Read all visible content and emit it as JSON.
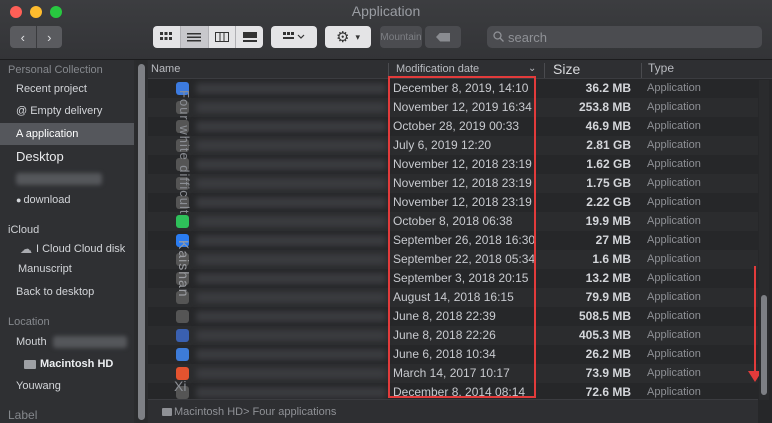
{
  "window": {
    "title": "Application",
    "search_placeholder": "search",
    "mountain_label": "Mountain",
    "nav_back": "‹",
    "nav_forward": "›"
  },
  "sidebar": {
    "personal_heading": "Personal Collection",
    "items": [
      {
        "label": "Recent project"
      },
      {
        "label": "@ Empty delivery"
      },
      {
        "label": "A application",
        "selected": true
      },
      {
        "label": "Desktop"
      },
      {
        "label": "download"
      }
    ],
    "icloud_heading": "iCloud",
    "icloud_items": [
      {
        "label": "I Cloud Cloud disk"
      },
      {
        "label": "Manuscript"
      },
      {
        "label": "Back to desktop"
      }
    ],
    "location_heading": "Location",
    "location_items": [
      {
        "label": "Mouth"
      },
      {
        "label": "Macintosh HD"
      },
      {
        "label": "Youwang"
      }
    ],
    "label_heading": "Label"
  },
  "columns": {
    "name": "Name",
    "date": "Modification date",
    "size": "Size",
    "type": "Type"
  },
  "vertical_overlay": {
    "text1": "Four white difficult",
    "text2": "Kaishan",
    "text3": "Xi"
  },
  "files": [
    {
      "date": "December 8, 2019, 14:10",
      "size": "36.2 MB",
      "type": "Application",
      "icon_color": "#3c7be0"
    },
    {
      "date": "November 12, 2019 16:34",
      "size": "253.8 MB",
      "type": "Application",
      "icon_color": "#555"
    },
    {
      "date": "October 28, 2019 00:33",
      "size": "46.9 MB",
      "type": "Application",
      "icon_color": "#555"
    },
    {
      "date": "July 6, 2019 12:20",
      "size": "2.81 GB",
      "type": "Application",
      "icon_color": "#555"
    },
    {
      "date": "November 12, 2018 23:19",
      "size": "1.62 GB",
      "type": "Application",
      "icon_color": "#555"
    },
    {
      "date": "November 12, 2018 23:19",
      "size": "1.75 GB",
      "type": "Application",
      "icon_color": "#555"
    },
    {
      "date": "November 12, 2018 23:19",
      "size": "2.22 GB",
      "type": "Application",
      "icon_color": "#555"
    },
    {
      "date": "October 8, 2018 06:38",
      "size": "19.9 MB",
      "type": "Application",
      "icon_color": "#2ec05a"
    },
    {
      "date": "September 26, 2018 16:30",
      "size": "27 MB",
      "type": "Application",
      "icon_color": "#2a7cf2"
    },
    {
      "date": "September 22, 2018 05:34",
      "size": "1.6 MB",
      "type": "Application",
      "icon_color": "#555"
    },
    {
      "date": "September 3, 2018 20:15",
      "size": "13.2 MB",
      "type": "Application",
      "icon_color": "#555"
    },
    {
      "date": "August 14, 2018 16:15",
      "size": "79.9 MB",
      "type": "Application",
      "icon_color": "#555"
    },
    {
      "date": "June 8, 2018 22:39",
      "size": "508.5 MB",
      "type": "Application",
      "icon_color": "#555"
    },
    {
      "date": "June 8, 2018 22:26",
      "size": "405.3 MB",
      "type": "Application",
      "icon_color": "#3a60b0"
    },
    {
      "date": "June 6, 2018 10:34",
      "size": "26.2 MB",
      "type": "Application",
      "icon_color": "#3d7bd8"
    },
    {
      "date": "March 14, 2017 10:17",
      "size": "73.9 MB",
      "type": "Application",
      "icon_color": "#e4532f"
    },
    {
      "date": "December 8, 2014 08:14",
      "size": "72.6 MB",
      "type": "Application",
      "icon_color": "#555"
    }
  ],
  "pathbar": {
    "text": "Macintosh HD> Four applications"
  },
  "colors": {
    "highlight": "#e23b3b",
    "selection": "#55575c"
  }
}
